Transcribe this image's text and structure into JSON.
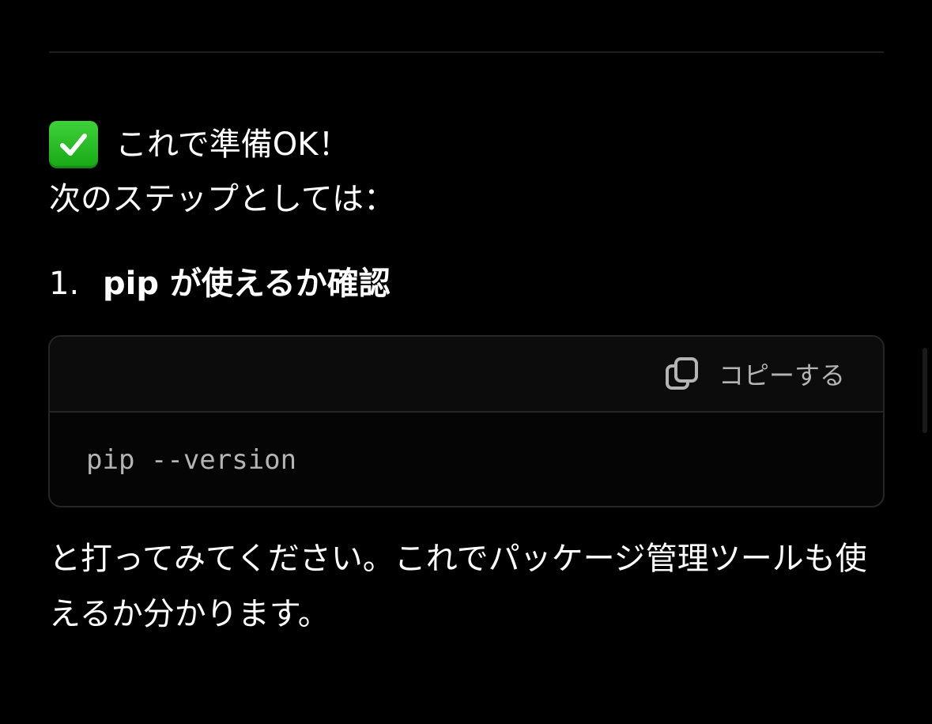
{
  "icons": {
    "ready": "check-mark-button-icon",
    "copy": "copy-icon"
  },
  "colors": {
    "background": "#000000",
    "text": "#ffffff",
    "code_text": "#b4b4b4",
    "check_green": "#2bbd27"
  },
  "message": {
    "ready_text": "これで準備OK！",
    "next_steps_intro": "次のステップとしては：",
    "step": {
      "number": "1.",
      "title": "pip が使えるか確認"
    },
    "code_block": {
      "copy_label": "コピーする",
      "code": "pip --version"
    },
    "description": "と打ってみてください。これでパッケージ管理ツールも使えるか分かります。"
  }
}
